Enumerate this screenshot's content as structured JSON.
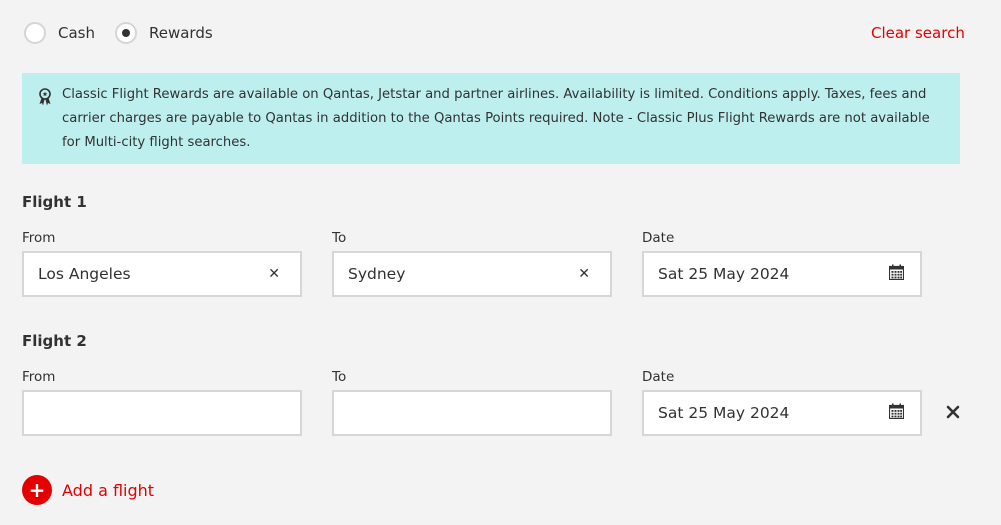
{
  "fare_type": {
    "options": [
      {
        "label": "Cash",
        "selected": false
      },
      {
        "label": "Rewards",
        "selected": true
      }
    ]
  },
  "clear_search_label": "Clear search",
  "notice": {
    "icon": "award-ribbon-icon",
    "text": "Classic Flight Rewards are available on Qantas, Jetstar and partner airlines. Availability is limited. Conditions apply. Taxes, fees and carrier charges are payable to Qantas in addition to the Qantas Points required. Note - Classic Plus Flight Rewards are not available for Multi-city flight searches."
  },
  "flights": [
    {
      "title": "Flight 1",
      "from_label": "From",
      "from_value": "Los Angeles",
      "to_label": "To",
      "to_value": "Sydney",
      "date_label": "Date",
      "date_value": "Sat 25 May 2024"
    },
    {
      "title": "Flight 2",
      "from_label": "From",
      "from_value": "",
      "to_label": "To",
      "to_value": "",
      "date_label": "Date",
      "date_value": "Sat 25 May 2024"
    }
  ],
  "add_flight_label": "Add a flight",
  "colors": {
    "accent": "#e40000",
    "notice_bg": "#bdefef",
    "page_bg": "#f3f3f4"
  }
}
